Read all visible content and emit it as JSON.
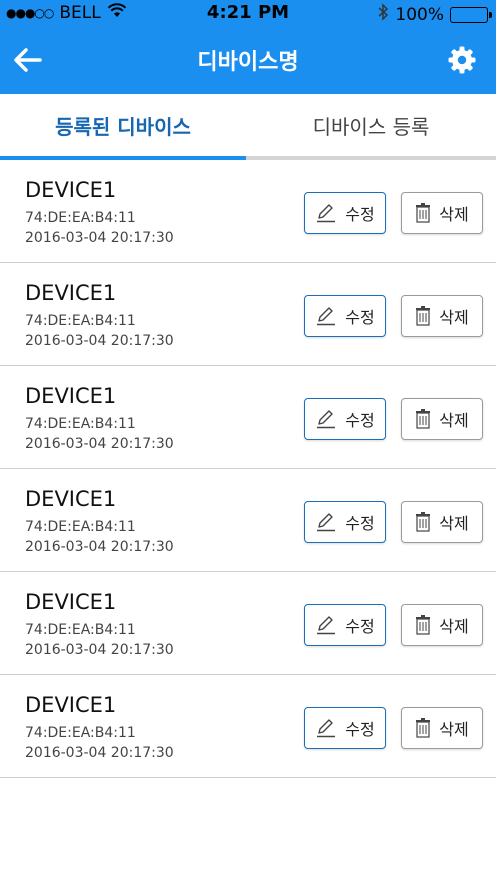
{
  "status_bar": {
    "signal": "●●●○○",
    "carrier": "BELL",
    "time": "4:21 PM",
    "battery": "100%"
  },
  "header": {
    "title": "디바이스명",
    "back_icon": "arrow-left-icon",
    "settings_icon": "gear-icon"
  },
  "tabs": [
    {
      "label": "등록된 디바이스",
      "active": true
    },
    {
      "label": "디바이스 등록",
      "active": false
    }
  ],
  "devices": [
    {
      "name": "DEVICE1",
      "mac": "74:DE:EA:B4:11",
      "date": "2016-03-04  20:17:30"
    },
    {
      "name": "DEVICE1",
      "mac": "74:DE:EA:B4:11",
      "date": "2016-03-04  20:17:30"
    },
    {
      "name": "DEVICE1",
      "mac": "74:DE:EA:B4:11",
      "date": "2016-03-04  20:17:30"
    },
    {
      "name": "DEVICE1",
      "mac": "74:DE:EA:B4:11",
      "date": "2016-03-04  20:17:30"
    },
    {
      "name": "DEVICE1",
      "mac": "74:DE:EA:B4:11",
      "date": "2016-03-04  20:17:30"
    },
    {
      "name": "DEVICE1",
      "mac": "74:DE:EA:B4:11",
      "date": "2016-03-04  20:17:30"
    }
  ],
  "actions": {
    "edit_label": "수정",
    "delete_label": "삭제",
    "edit_icon": "pencil-icon",
    "delete_icon": "trash-icon"
  },
  "colors": {
    "primary": "#1a8ff0",
    "active_tab_text": "#1666b0",
    "edit_border": "#1a6fb8",
    "delete_border": "#9a9a9a"
  }
}
